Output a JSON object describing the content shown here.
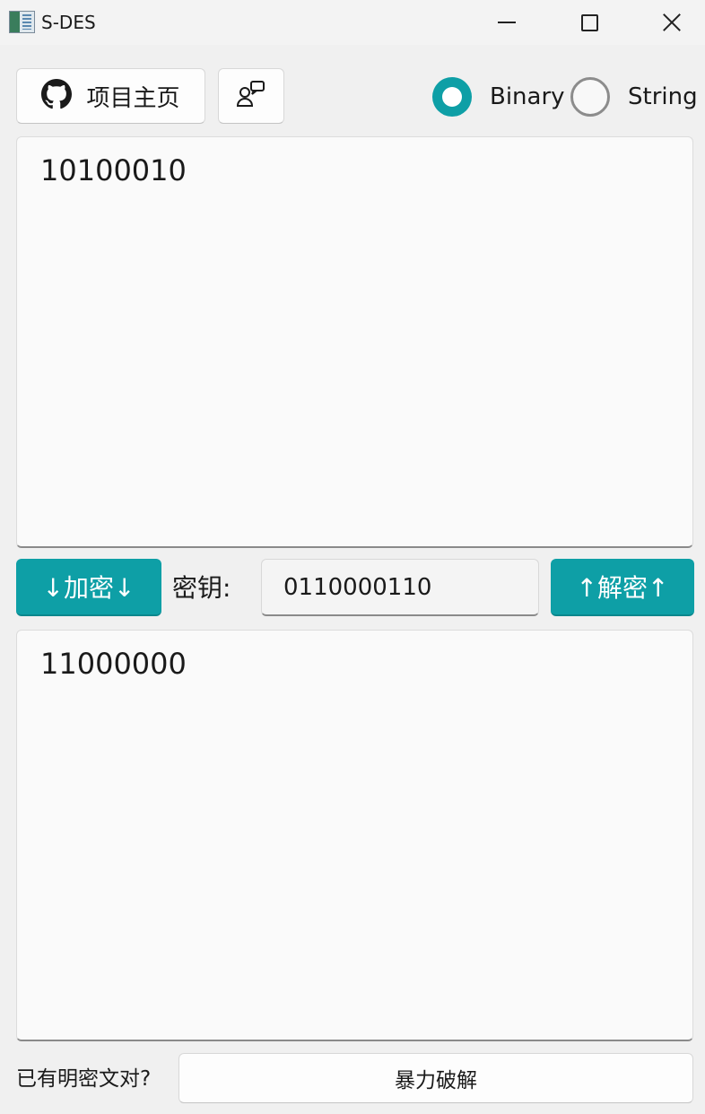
{
  "window": {
    "title": "S-DES",
    "minimize_icon": "minimize-icon",
    "maximize_icon": "maximize-icon",
    "close_icon": "close-icon"
  },
  "toolbar": {
    "home_label": "项目主页",
    "home_icon": "github-icon",
    "chat_icon": "chat-icon"
  },
  "mode": {
    "options": [
      {
        "label": "Binary",
        "selected": true
      },
      {
        "label": "String",
        "selected": false
      }
    ]
  },
  "plaintext": {
    "value": "10100010"
  },
  "actions": {
    "encrypt_label": "↓加密↓",
    "decrypt_label": "↑解密↑",
    "key_label": "密钥:",
    "key_value": "0110000110"
  },
  "ciphertext": {
    "value": "11000000"
  },
  "footer": {
    "pair_label": "已有明密文对?",
    "brute_force_label": "暴力破解"
  },
  "colors": {
    "accent": "#0e9fa6",
    "background": "#f0f0f0",
    "textarea_bg": "#fafafa"
  }
}
